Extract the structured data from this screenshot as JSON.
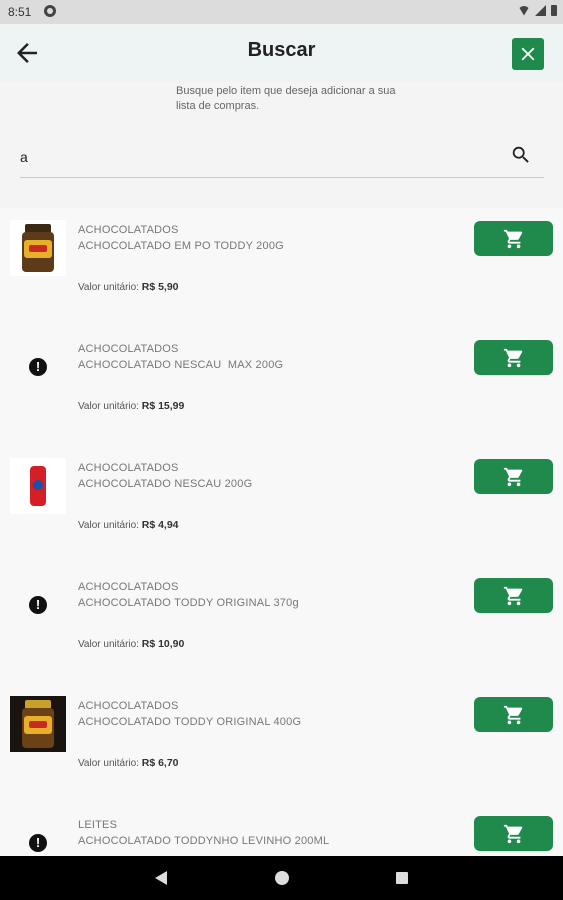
{
  "status_bar": {
    "time": "8:51"
  },
  "header": {
    "title": "Buscar"
  },
  "hint": "Busque pelo item que deseja adicionar a sua lista de compras.",
  "search": {
    "value": "a",
    "placeholder": ""
  },
  "price_label": "Valor unitário:",
  "items": [
    {
      "category": "ACHOCOLATADOS",
      "name": "ACHOCOLATADO EM PO TODDY 200G",
      "price_label": "Valor unitário:",
      "price": "R$ 5,90",
      "image": "jar"
    },
    {
      "category": "ACHOCOLATADOS",
      "name": "ACHOCOLATADO NESCAU  MAX 200G",
      "price_label": "Valor unitário:",
      "price": "R$ 15,99",
      "image": "warning-icon"
    },
    {
      "category": "ACHOCOLATADOS",
      "name": "ACHOCOLATADO NESCAU 200G",
      "price_label": "Valor unitário:",
      "price": "R$ 4,94",
      "image": "can"
    },
    {
      "category": "ACHOCOLATADOS",
      "name": "ACHOCOLATADO TODDY ORIGINAL 370g",
      "price_label": "Valor unitário:",
      "price": "R$ 10,90",
      "image": "warning-icon"
    },
    {
      "category": "ACHOCOLATADOS",
      "name": "ACHOCOLATADO TODDY ORIGINAL 400G",
      "price_label": "Valor unitário:",
      "price": "R$ 6,70",
      "image": "jar-dark"
    },
    {
      "category": "LEITES",
      "name": "ACHOCOLATADO TODDYNHO LEVINHO 200ML",
      "price_label": "Valor unitário:",
      "price": "",
      "image": "warning-icon"
    }
  ],
  "colors": {
    "accent": "#1f8a4c",
    "header_bg": "#eef3f3",
    "navbar": "#000000"
  },
  "icons": {
    "back": "arrow-left-icon",
    "close": "close-icon",
    "search": "search-icon",
    "cart": "shopping-cart-icon",
    "warning": "exclamation-circle-icon"
  }
}
